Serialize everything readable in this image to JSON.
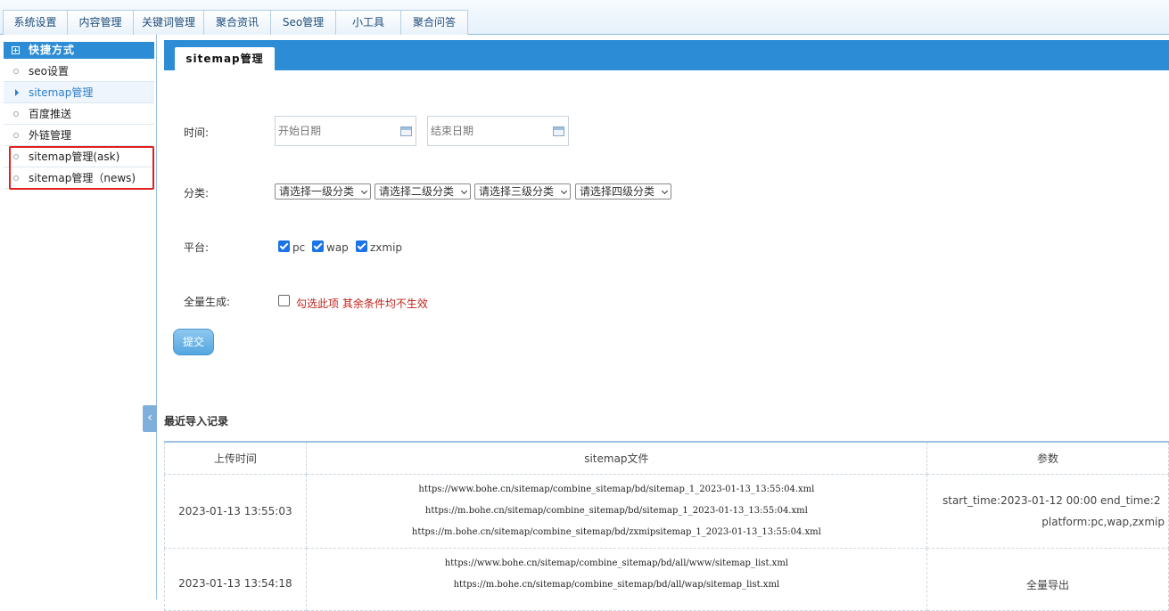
{
  "topnav": {
    "tabs": [
      "系统设置",
      "内容管理",
      "关键词管理",
      "聚合资讯",
      "Seo管理",
      "小工具",
      "聚合问答"
    ]
  },
  "sidebar": {
    "title": "快捷方式",
    "items": [
      {
        "label": "seo设置",
        "active": false
      },
      {
        "label": "sitemap管理",
        "active": true
      },
      {
        "label": "百度推送",
        "active": false
      },
      {
        "label": "外链管理",
        "active": false
      },
      {
        "label": "sitemap管理(ask)",
        "active": false
      },
      {
        "label": "sitemap管理（news)",
        "active": false
      }
    ]
  },
  "main": {
    "tab_title": "sitemap管理",
    "form": {
      "time_label": "时间:",
      "start_placeholder": "开始日期",
      "end_placeholder": "结束日期",
      "category_label": "分类:",
      "selects": [
        "请选择一级分类",
        "请选择二级分类",
        "请选择三级分类",
        "请选择四级分类"
      ],
      "platform_label": "平台:",
      "platforms": [
        {
          "label": "pc",
          "checked": true
        },
        {
          "label": "wap",
          "checked": true
        },
        {
          "label": "zxmip",
          "checked": true
        }
      ],
      "full_label": "全量生成:",
      "full_hint": "勾选此项 其余条件均不生效",
      "submit_label": "提交"
    },
    "records": {
      "title": "最近导入记录",
      "headers": [
        "上传时间",
        "sitemap文件",
        "参数"
      ],
      "rows": [
        {
          "time": "2023-01-13 13:55:03",
          "files": [
            "https://www.bohe.cn/sitemap/combine_sitemap/bd/sitemap_1_2023-01-13_13:55:04.xml",
            "https://m.bohe.cn/sitemap/combine_sitemap/bd/sitemap_1_2023-01-13_13:55:04.xml",
            "https://m.bohe.cn/sitemap/combine_sitemap/bd/zxmipsitemap_1_2023-01-13_13:55:04.xml"
          ],
          "params": [
            "start_time:2023-01-12 00:00 end_time:2",
            "platform:pc,wap,zxmip"
          ]
        },
        {
          "time": "2023-01-13 13:54:18",
          "files": [
            "https://www.bohe.cn/sitemap/combine_sitemap/bd/all/www/sitemap_list.xml",
            "https://m.bohe.cn/sitemap/combine_sitemap/bd/all/wap/sitemap_list.xml"
          ],
          "params": [
            "全量导出"
          ]
        }
      ]
    }
  }
}
